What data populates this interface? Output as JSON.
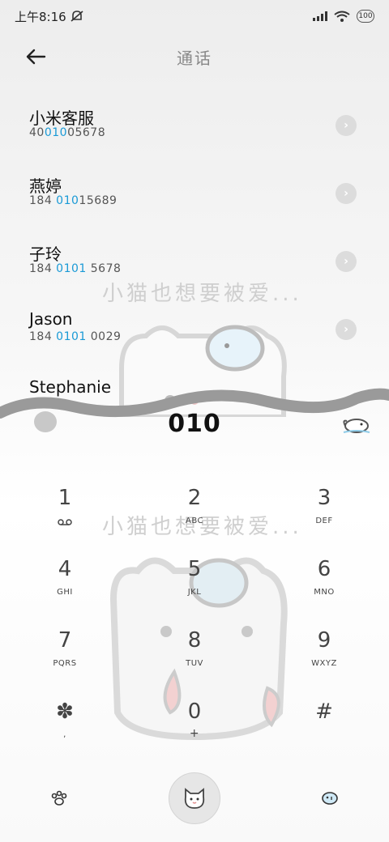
{
  "status": {
    "time": "上午8:16",
    "battery": "100",
    "icons": [
      "mute-icon",
      "signal-icon",
      "wifi-icon",
      "battery-icon"
    ]
  },
  "header": {
    "title": "通话",
    "back_icon": "arrow-left-icon"
  },
  "contacts": [
    {
      "name": "小米客服",
      "num_pre": "40",
      "num_hl": "010",
      "num_post": "05678"
    },
    {
      "name": "燕婷",
      "num_pre": "184 ",
      "num_hl": "010",
      "num_post": "15689"
    },
    {
      "name": "子玲",
      "num_pre": "184 ",
      "num_hl": "0101",
      "num_post": " 5678"
    },
    {
      "name": "Jason",
      "num_pre": "184 ",
      "num_hl": "0101",
      "num_post": " 0029"
    },
    {
      "name": "Stephanie",
      "num_pre": "",
      "num_hl": "",
      "num_post": ""
    }
  ],
  "dial": {
    "entered": "010"
  },
  "watermark": "小猫也想要被爱...",
  "keypad": [
    {
      "digit": "1",
      "letters": "",
      "sub_icon": "voicemail-icon"
    },
    {
      "digit": "2",
      "letters": "ABC"
    },
    {
      "digit": "3",
      "letters": "DEF"
    },
    {
      "digit": "4",
      "letters": "GHI"
    },
    {
      "digit": "5",
      "letters": "JKL"
    },
    {
      "digit": "6",
      "letters": "MNO"
    },
    {
      "digit": "7",
      "letters": "PQRS"
    },
    {
      "digit": "8",
      "letters": "TUV"
    },
    {
      "digit": "9",
      "letters": "WXYZ"
    },
    {
      "digit": "✽",
      "letters": ","
    },
    {
      "digit": "0",
      "letters": "+"
    },
    {
      "digit": "#",
      "letters": ""
    }
  ],
  "bottom": {
    "left_icon": "paw-icon",
    "call_icon": "cat-call-icon",
    "right_icon": "fish-icon"
  },
  "colors": {
    "highlight": "#1a9ad6",
    "wave": "#9a9a9a"
  }
}
